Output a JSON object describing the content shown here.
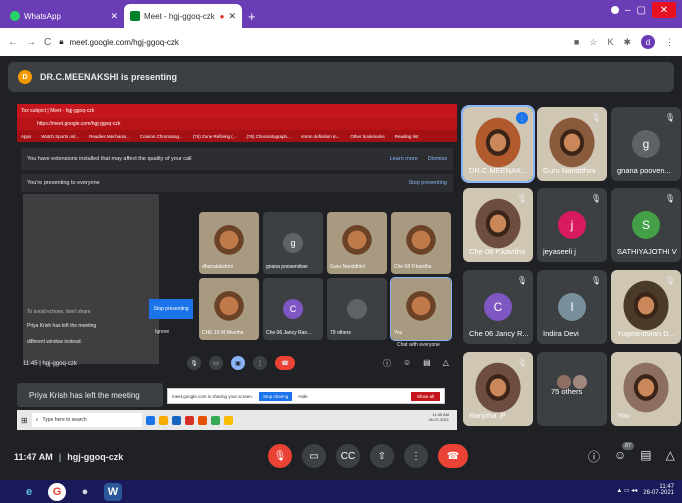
{
  "browser": {
    "tabs": [
      {
        "label": "WhatsApp",
        "icon": "whatsapp-icon",
        "color": "#25d366"
      },
      {
        "label": "Meet - hgj-ggoq-czk",
        "icon": "meet-icon",
        "color": "#00832d"
      }
    ],
    "new_tab": "+",
    "url": "meet.google.com/hgj-ggoq-czk",
    "profile_initial": "d"
  },
  "presenting_banner": {
    "initial": "D",
    "text": "DR.C.MEENAKSHI is presenting"
  },
  "shared_screen": {
    "tabs_text": "Tox subject | Meet - hgj-ggoq-czk",
    "url": "https://meet.google.com/hgj-ggoq-czk",
    "bookmarks": [
      "Apps",
      "Watch Sports onl...",
      "Readies Mechanis...",
      "Column Chromatog...",
      "(76) Zone Refining (...",
      "(76) Chromatograph...",
      "retron definition in...",
      "Other bookmarks",
      "Reading list"
    ],
    "warning": "You have extensions installed that may affect the quality of your call",
    "learn_more": "Learn more",
    "dismiss": "Dismiss",
    "presenting_to": "You're presenting to everyone",
    "stop_presenting": "Stop presenting",
    "tiles": [
      {
        "name": "dhanalakshmi",
        "kind": "photo"
      },
      {
        "name": "gnana poovendran",
        "kind": "avatar",
        "initial": "g",
        "color": "#5f6368"
      },
      {
        "name": "Guru Nanddhini",
        "kind": "photo"
      },
      {
        "name": "Che 08 P.kavitha",
        "kind": "photo"
      },
      {
        "name": "CHE 15 M.Nivetha",
        "kind": "photo"
      },
      {
        "name": "Che 06 Jancy Ran...",
        "kind": "avatar",
        "initial": "C",
        "color": "#7e57c2"
      },
      {
        "name": "79 others",
        "kind": "avatar",
        "initial": "",
        "color": "#5f6368"
      },
      {
        "name": "You",
        "kind": "photo"
      }
    ],
    "chat_label": "Chat with everyone",
    "toast": "Priya Krish has left the meeting",
    "toast_sub": "different window instead.",
    "hint": "To avoid echoes, don't share",
    "stop_btn": "Stop presenting",
    "ignore": "Ignore",
    "time_code": "11:45 | hgj-ggoq-czk",
    "notice_text": "meet.google.com is sharing your screen.",
    "notice_stop": "Stop sharing",
    "notice_hide": "Hide",
    "show_all": "Show all",
    "search_placeholder": "Type here to search",
    "clock": "11:45 AM",
    "date": "26-07-2021"
  },
  "toast": "Priya Krish has left the meeting",
  "participants": [
    {
      "name": "DR.C.MEENAK...",
      "kind": "photo",
      "speaking": true
    },
    {
      "name": "Guru Nanddhini",
      "kind": "photo"
    },
    {
      "name": "gnana pooven...",
      "kind": "avatar",
      "initial": "g",
      "color": "#5f6368"
    },
    {
      "name": "Che 08 P.kavitha",
      "kind": "photo"
    },
    {
      "name": "jeyaseeli j",
      "kind": "avatar",
      "initial": "j",
      "color": "#d81b60"
    },
    {
      "name": "SATHIYAJOTHI V",
      "kind": "avatar",
      "initial": "S",
      "color": "#43a047"
    },
    {
      "name": "Che 06 Jancy R...",
      "kind": "avatar",
      "initial": "C",
      "color": "#7e57c2"
    },
    {
      "name": "Indira Devi",
      "kind": "avatar",
      "initial": "I",
      "color": "#78909c"
    },
    {
      "name": "Yugeanthiran D...",
      "kind": "photo"
    },
    {
      "name": "Ranjitha .P",
      "kind": "photo"
    },
    {
      "name": "75 others",
      "kind": "others"
    },
    {
      "name": "You",
      "kind": "photo",
      "self": true
    }
  ],
  "meeting": {
    "time": "11:47 AM",
    "separator": "|",
    "code": "hgj-ggoq-czk",
    "people_count": "87"
  },
  "tray": {
    "time": "11:47",
    "date": "26-07-2021"
  }
}
